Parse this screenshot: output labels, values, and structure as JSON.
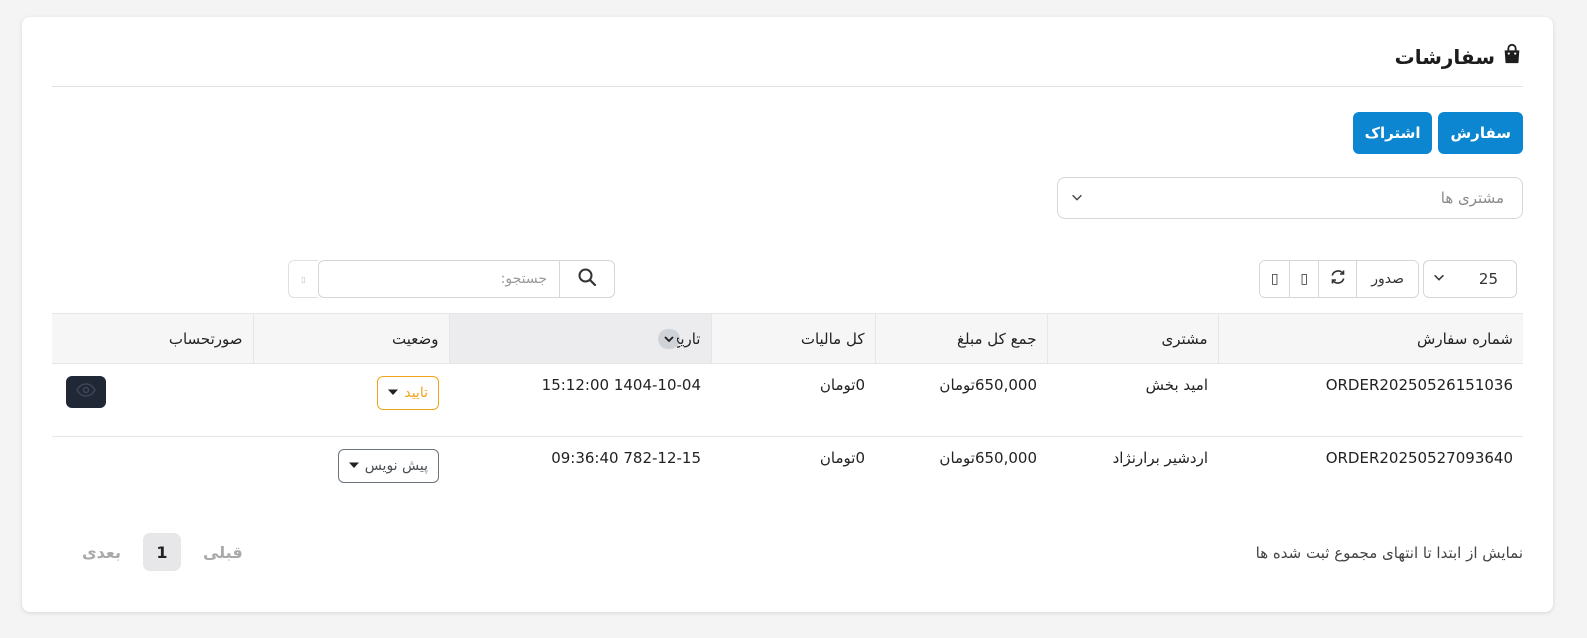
{
  "header": {
    "title": "سفارشات",
    "icon": "shopping-bag-icon"
  },
  "tabs": {
    "orders_label": "سفارش",
    "subscription_label": "اشتراک"
  },
  "filters": {
    "customer_placeholder": "مشتری ها"
  },
  "toolbar": {
    "page_size": "25",
    "export_label": "صدور",
    "search_placeholder": "جستجو:"
  },
  "table": {
    "columns": {
      "order_number": "شماره سفارش",
      "customer": "مشتری",
      "total_amount": "جمع کل مبلغ",
      "total_tax": "کل مالیات",
      "date": "تاریخ",
      "status": "وضعیت",
      "invoice": "صورتحساب"
    },
    "rows": [
      {
        "order_number": "ORDER20250526151036",
        "customer": "امید بخش",
        "total_amount": "650,000تومان",
        "total_tax": "0تومان",
        "date": "1404-10-04 15:12:00",
        "status": "تایید",
        "has_invoice": true
      },
      {
        "order_number": "ORDER20250527093640",
        "customer": "اردشیر برارنژاد",
        "total_amount": "650,000تومان",
        "total_tax": "0تومان",
        "date": "782-12-15 09:36:40",
        "status": "پیش نویس",
        "has_invoice": false
      }
    ]
  },
  "footer": {
    "info": "نمایش از ابتدا تا انتهای مجموع ثبت شده ها",
    "prev_label": "قبلی",
    "current_page": "1",
    "next_label": "بعدی"
  },
  "colors": {
    "primary": "#0d86d1",
    "approved": "#f0a419",
    "draft": "#6c757d",
    "dark_button": "#202836"
  }
}
